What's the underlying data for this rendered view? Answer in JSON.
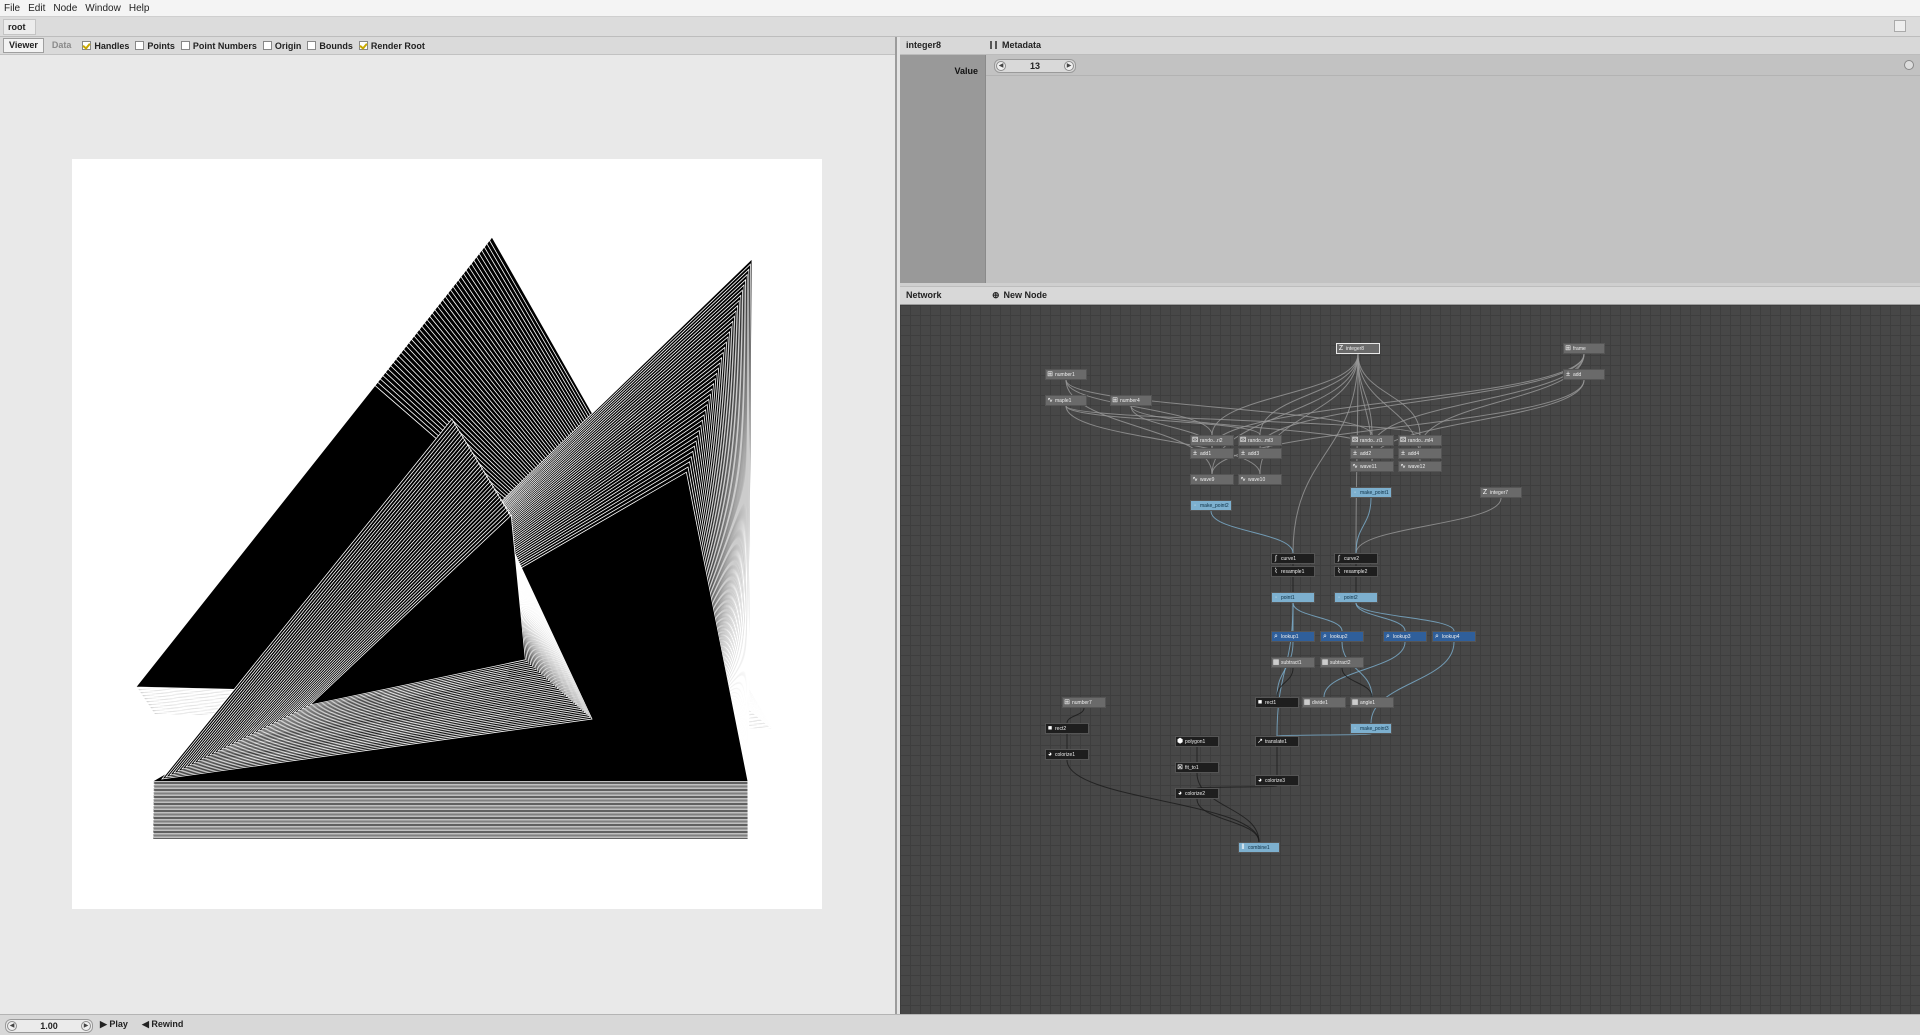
{
  "menubar": {
    "items": [
      "File",
      "Edit",
      "Node",
      "Window",
      "Help"
    ]
  },
  "address": {
    "crumb": "root"
  },
  "viewer": {
    "tabs": [
      {
        "label": "Viewer",
        "active": true
      },
      {
        "label": "Data",
        "active": false
      }
    ],
    "options": [
      {
        "label": "Handles",
        "checked": true
      },
      {
        "label": "Points",
        "checked": false
      },
      {
        "label": "Point Numbers",
        "checked": false
      },
      {
        "label": "Origin",
        "checked": false
      },
      {
        "label": "Bounds",
        "checked": false
      },
      {
        "label": "Render Root",
        "checked": true
      }
    ]
  },
  "ports": {
    "node_name": "integer8",
    "metadata_label": "Metadata",
    "value_label": "Value",
    "value": "13"
  },
  "network": {
    "title": "Network",
    "new_node_label": "New Node",
    "nodes": [
      {
        "name": "integer8",
        "style": "gray",
        "icon": "integer-icon",
        "glyph": "Z",
        "selected": true
      },
      {
        "name": "frame",
        "style": "gray",
        "icon": "frame-icon",
        "glyph": "⊞"
      },
      {
        "name": "add",
        "style": "gray",
        "icon": "add-icon",
        "glyph": "±"
      },
      {
        "name": "number1",
        "style": "gray",
        "icon": "number-icon",
        "glyph": "⊞"
      },
      {
        "name": "maple1",
        "style": "gray",
        "icon": "node-icon",
        "glyph": "∿"
      },
      {
        "name": "number4",
        "style": "gray",
        "icon": "number-icon",
        "glyph": "⊞"
      },
      {
        "name": "rando...ri2",
        "style": "gray",
        "icon": "random-icon",
        "glyph": "⚄"
      },
      {
        "name": "rando...ml3",
        "style": "gray",
        "icon": "random-icon",
        "glyph": "⚄"
      },
      {
        "name": "add1",
        "style": "gray",
        "icon": "add-icon",
        "glyph": "±"
      },
      {
        "name": "add3",
        "style": "gray",
        "icon": "add-icon",
        "glyph": "±"
      },
      {
        "name": "wave9",
        "style": "gray",
        "icon": "wave-icon",
        "glyph": "∿"
      },
      {
        "name": "wave10",
        "style": "gray",
        "icon": "wave-icon",
        "glyph": "∿"
      },
      {
        "name": "make_point2",
        "style": "light",
        "icon": "point-icon",
        "glyph": "·"
      },
      {
        "name": "rando...ri1",
        "style": "gray",
        "icon": "random-icon",
        "glyph": "⚄"
      },
      {
        "name": "rando...ml4",
        "style": "gray",
        "icon": "random-icon",
        "glyph": "⚄"
      },
      {
        "name": "add2",
        "style": "gray",
        "icon": "add-icon",
        "glyph": "±"
      },
      {
        "name": "add4",
        "style": "gray",
        "icon": "add-icon",
        "glyph": "±"
      },
      {
        "name": "wave11",
        "style": "gray",
        "icon": "wave-icon",
        "glyph": "∿"
      },
      {
        "name": "wave12",
        "style": "gray",
        "icon": "wave-icon",
        "glyph": "∿"
      },
      {
        "name": "make_point1",
        "style": "light",
        "icon": "point-icon",
        "glyph": "·"
      },
      {
        "name": "integer7",
        "style": "gray",
        "icon": "integer-icon",
        "glyph": "Z"
      },
      {
        "name": "curve1",
        "style": "black",
        "icon": "curve-icon",
        "glyph": "∫"
      },
      {
        "name": "curve2",
        "style": "black",
        "icon": "curve-icon",
        "glyph": "∫"
      },
      {
        "name": "resample1",
        "style": "black",
        "icon": "resample-icon",
        "glyph": "⌇"
      },
      {
        "name": "resample2",
        "style": "black",
        "icon": "resample-icon",
        "glyph": "⌇"
      },
      {
        "name": "point1",
        "style": "light",
        "icon": "point-icon",
        "glyph": "·"
      },
      {
        "name": "point2",
        "style": "light",
        "icon": "point-icon",
        "glyph": "·"
      },
      {
        "name": "lookup1",
        "style": "blue",
        "icon": "lookup-icon",
        "glyph": "⌕"
      },
      {
        "name": "lookup2",
        "style": "blue",
        "icon": "lookup-icon",
        "glyph": "⌕"
      },
      {
        "name": "lookup3",
        "style": "blue",
        "icon": "lookup-icon",
        "glyph": "⌕"
      },
      {
        "name": "lookup4",
        "style": "blue",
        "icon": "lookup-icon",
        "glyph": "⌕"
      },
      {
        "name": "subtract1",
        "style": "gray",
        "icon": "subtract-icon",
        "glyph": "▦"
      },
      {
        "name": "subtract2",
        "style": "gray",
        "icon": "subtract-icon",
        "glyph": "▦"
      },
      {
        "name": "rect1",
        "style": "black",
        "icon": "rect-icon",
        "glyph": "■"
      },
      {
        "name": "divide1",
        "style": "gray",
        "icon": "divide-icon",
        "glyph": "▦"
      },
      {
        "name": "angle1",
        "style": "gray",
        "icon": "angle-icon",
        "glyph": "▦"
      },
      {
        "name": "make_point3",
        "style": "light",
        "icon": "point-icon",
        "glyph": "·"
      },
      {
        "name": "number7",
        "style": "gray",
        "icon": "number-icon",
        "glyph": "⊞"
      },
      {
        "name": "rect2",
        "style": "black",
        "icon": "rect-icon",
        "glyph": "■"
      },
      {
        "name": "colorize1",
        "style": "black",
        "icon": "colorize-icon",
        "glyph": "◕"
      },
      {
        "name": "polygon1",
        "style": "black",
        "icon": "polygon-icon",
        "glyph": "⬢"
      },
      {
        "name": "fit_to1",
        "style": "black",
        "icon": "fit-icon",
        "glyph": "⊠"
      },
      {
        "name": "colorize2",
        "style": "black",
        "icon": "colorize-icon",
        "glyph": "◕"
      },
      {
        "name": "translate1",
        "style": "black",
        "icon": "translate-icon",
        "glyph": "↗"
      },
      {
        "name": "colorize3",
        "style": "black",
        "icon": "colorize-icon",
        "glyph": "◕"
      },
      {
        "name": "combine1",
        "style": "light",
        "icon": "combine-icon",
        "glyph": "⫴"
      }
    ]
  },
  "timebar": {
    "frame": "1.00",
    "play_label": "Play",
    "rewind_label": "Rewind"
  },
  "colors": {
    "network_bg": "#474747",
    "node_gray": "#6a6a6a",
    "node_black": "#1e1e1e",
    "node_light": "#7db0cf",
    "node_blue": "#2f5f9b",
    "wire_gray": "#9a9a9a",
    "wire_blue": "#7db0cf"
  }
}
